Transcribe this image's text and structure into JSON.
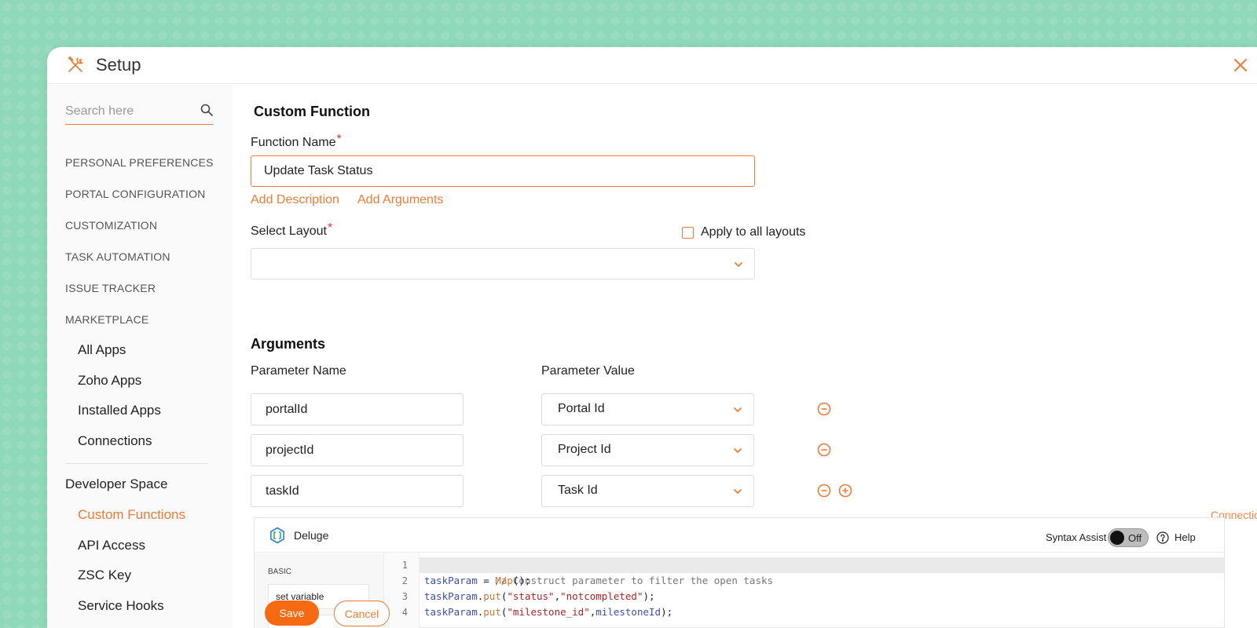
{
  "window": {
    "title": "Setup"
  },
  "sidebar": {
    "search_placeholder": "Search here",
    "sections": [
      "PERSONAL PREFERENCES",
      "PORTAL CONFIGURATION",
      "CUSTOMIZATION",
      "TASK AUTOMATION",
      "ISSUE TRACKER",
      "MARKETPLACE"
    ],
    "marketplace_items": [
      "All Apps",
      "Zoho Apps",
      "Installed Apps",
      "Connections"
    ],
    "developer_space": {
      "label": "Developer Space",
      "items": [
        "Custom Functions",
        "API Access",
        "ZSC Key",
        "Service Hooks"
      ],
      "active": "Custom Functions"
    }
  },
  "form": {
    "page_title": "Custom Function",
    "function_name_label": "Function Name",
    "function_name_value": "Update Task Status",
    "required_mark": "*",
    "add_description": "Add Description",
    "add_arguments": "Add Arguments",
    "select_layout_label": "Select Layout",
    "apply_all_label": "Apply to all layouts",
    "select_layout_value": "",
    "arguments_title": "Arguments",
    "param_name_header": "Parameter Name",
    "param_value_header": "Parameter Value",
    "equals": "=",
    "arguments": [
      {
        "name": "portalId",
        "value": "Portal Id"
      },
      {
        "name": "projectId",
        "value": "Project Id"
      },
      {
        "name": "taskId",
        "value": "Task Id"
      }
    ],
    "connections_link": "Connections",
    "connections_arrow": "»"
  },
  "editor": {
    "language": "Deluge",
    "syntax_assist_label": "Syntax Assist",
    "syntax_assist_state": "Off",
    "help_label": "Help",
    "palette_category": "BASIC",
    "palette_items": [
      "set variable",
      ""
    ],
    "line_numbers": [
      "1",
      "2",
      "3",
      "4"
    ],
    "code": {
      "line1": "// Construct parameter to filter the open tasks",
      "line2": {
        "var": "taskParam",
        "eq": " = ",
        "fn": "Map",
        "end": "();"
      },
      "line3": {
        "var": "taskParam",
        "dot": ".",
        "fn": "put",
        "open": "(",
        "s1": "\"status\"",
        "comma": ",",
        "s2": "\"notcompleted\"",
        "end": ");"
      },
      "line4": {
        "var": "taskParam",
        "dot": ".",
        "fn": "put",
        "open": "(",
        "s1": "\"milestone_id\"",
        "comma": ",",
        "arg": "milestoneId",
        "end": ");"
      }
    }
  },
  "actions": {
    "save": "Save",
    "cancel": "Cancel"
  },
  "colors": {
    "accent": "#f27b34",
    "save_bg": "#f86a12",
    "background": "#8fd8b9"
  },
  "icons": {
    "app": "tools-icon",
    "close": "close-icon",
    "search": "search-icon",
    "chevron": "chevron-down-icon",
    "remove": "minus-circle-icon",
    "add": "plus-circle-icon",
    "help": "help-icon",
    "deluge": "deluge-icon"
  }
}
